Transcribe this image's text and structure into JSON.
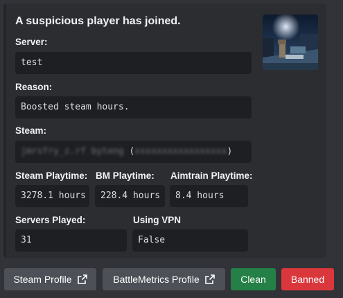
{
  "embed": {
    "title": "A suspicious player has joined.",
    "fields": {
      "server": {
        "name": "Server:",
        "value": "test"
      },
      "reason": {
        "name": "Reason:",
        "value": "Boosted steam hours."
      },
      "steam": {
        "name": "Steam:",
        "value_blurred_name": "jmrsfry_z.rf byteng",
        "open_paren": "(",
        "value_blurred_id": "xxxxxxxxxxxxxxxxx",
        "close_paren": ")"
      },
      "steam_playtime": {
        "name": "Steam Playtime:",
        "value": "3278.1 hours"
      },
      "bm_playtime": {
        "name": "BM Playtime:",
        "value": "228.4 hours"
      },
      "aimtrain_playtime": {
        "name": "Aimtrain Playtime:",
        "value": "8.4 hours"
      },
      "servers_played": {
        "name": "Servers Played:",
        "value": "31"
      },
      "using_vpn": {
        "name": "Using VPN",
        "value": "False"
      }
    }
  },
  "buttons": {
    "steam_profile": "Steam Profile",
    "battlemetrics_profile": "BattleMetrics Profile",
    "clean": "Clean",
    "banned": "Banned"
  },
  "colors": {
    "background": "#313338",
    "embed": "#2b2d31",
    "code_block": "#1e1f22",
    "button_gray": "#4e5058",
    "button_green": "#248046",
    "button_red": "#da373c"
  },
  "icons": [
    "external-link-icon",
    "avatar-thumbnail"
  ]
}
